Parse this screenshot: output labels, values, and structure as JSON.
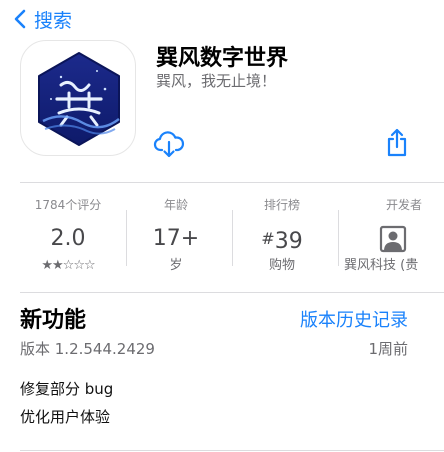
{
  "nav": {
    "back_label": "搜索",
    "back_icon": "chevron-left-icon"
  },
  "app": {
    "name": "巽风数字世界",
    "subtitle": "巽风，我无止境！",
    "icon_name": "xunfeng-app-icon",
    "accent_color": "#1a82fb"
  },
  "actions": {
    "download_icon": "cloud-download-icon",
    "share_icon": "share-icon"
  },
  "stats": {
    "ratings": {
      "header": "1784个评分",
      "value": "2.0",
      "stars": 2,
      "max_stars": 5
    },
    "age": {
      "header": "年龄",
      "value": "17+",
      "footer": "岁"
    },
    "chart": {
      "header": "排行榜",
      "hash": "#",
      "value": "39",
      "footer": "购物"
    },
    "developer": {
      "header": "开发者",
      "icon": "person-icon",
      "footer": "巽风科技 (贵"
    }
  },
  "whats_new": {
    "title": "新功能",
    "history_link": "版本历史记录",
    "version": "版本 1.2.544.2429",
    "time_ago": "1周前",
    "notes": [
      "修复部分 bug",
      "优化用户体验"
    ]
  }
}
